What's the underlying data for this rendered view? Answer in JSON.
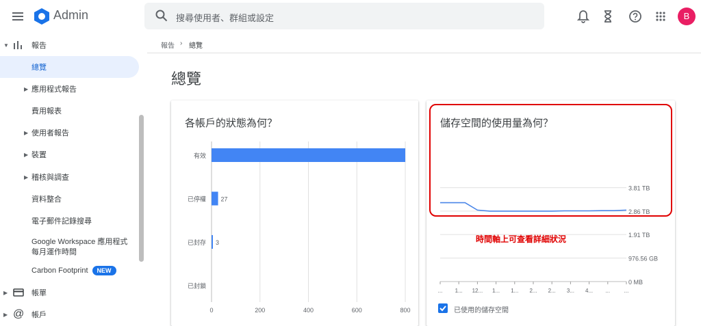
{
  "header": {
    "app_name": "Admin",
    "search_placeholder": "搜尋使用者、群組或設定",
    "avatar_letter": "B"
  },
  "sidebar": {
    "items": [
      {
        "label": "報告"
      },
      {
        "label": "總覽"
      },
      {
        "label": "應用程式報告"
      },
      {
        "label": "費用報表"
      },
      {
        "label": "使用者報告"
      },
      {
        "label": "裝置"
      },
      {
        "label": "稽核與調查"
      },
      {
        "label": "資料整合"
      },
      {
        "label": "電子郵件記錄搜尋"
      },
      {
        "label": "Google Workspace 應用程式"
      },
      {
        "label": "每月運作時間"
      },
      {
        "label": "Carbon Footprint"
      },
      {
        "label": "帳單"
      },
      {
        "label": "帳戶"
      }
    ],
    "new_badge": "NEW"
  },
  "breadcrumb": {
    "root": "報告",
    "sep": "›",
    "current": "總覽"
  },
  "page_title": "總覽",
  "cards": {
    "accounts": {
      "title": "各帳戶的狀態為何？",
      "categories": [
        "有效",
        "已停權",
        "已封存",
        "已封鎖"
      ],
      "value_labels": [
        "",
        "27",
        "3",
        ""
      ],
      "x_ticks": [
        "0",
        "200",
        "400",
        "600",
        "800"
      ]
    },
    "storage": {
      "title": "儲存空間的使用量為何？",
      "y_ticks": [
        "3.81 TB",
        "2.86 TB",
        "1.91 TB",
        "976.56 GB",
        "0 MB"
      ],
      "x_ticks": [
        "...",
        "1...",
        "12...",
        "1...",
        "1...",
        "2...",
        "2...",
        "3...",
        "4...",
        "...",
        "..."
      ],
      "legend": "已使用的儲存空間",
      "annotation": "時間軸上可查看詳細狀況"
    }
  },
  "chart_data": [
    {
      "type": "bar",
      "title": "各帳戶的狀態為何？",
      "categories": [
        "有效",
        "已停權",
        "已封存",
        "已封鎖"
      ],
      "values": [
        800,
        27,
        3,
        0
      ],
      "xlim": [
        0,
        800
      ]
    },
    {
      "type": "line",
      "title": "儲存空間的使用量為何？",
      "series": [
        {
          "name": "已使用的儲存空間",
          "values": [
            3.2,
            3.2,
            3.2,
            2.9,
            2.86,
            2.86,
            2.86,
            2.86,
            2.86,
            2.86,
            2.87,
            2.87,
            2.87,
            2.88,
            2.88,
            2.9
          ]
        }
      ],
      "ylim": [
        0,
        4.77
      ],
      "colors": {
        "line": "#4a86e8"
      }
    }
  ],
  "colors": {
    "accent": "#1a73e8",
    "bar": "#4285f4",
    "highlight": "#e00000"
  }
}
